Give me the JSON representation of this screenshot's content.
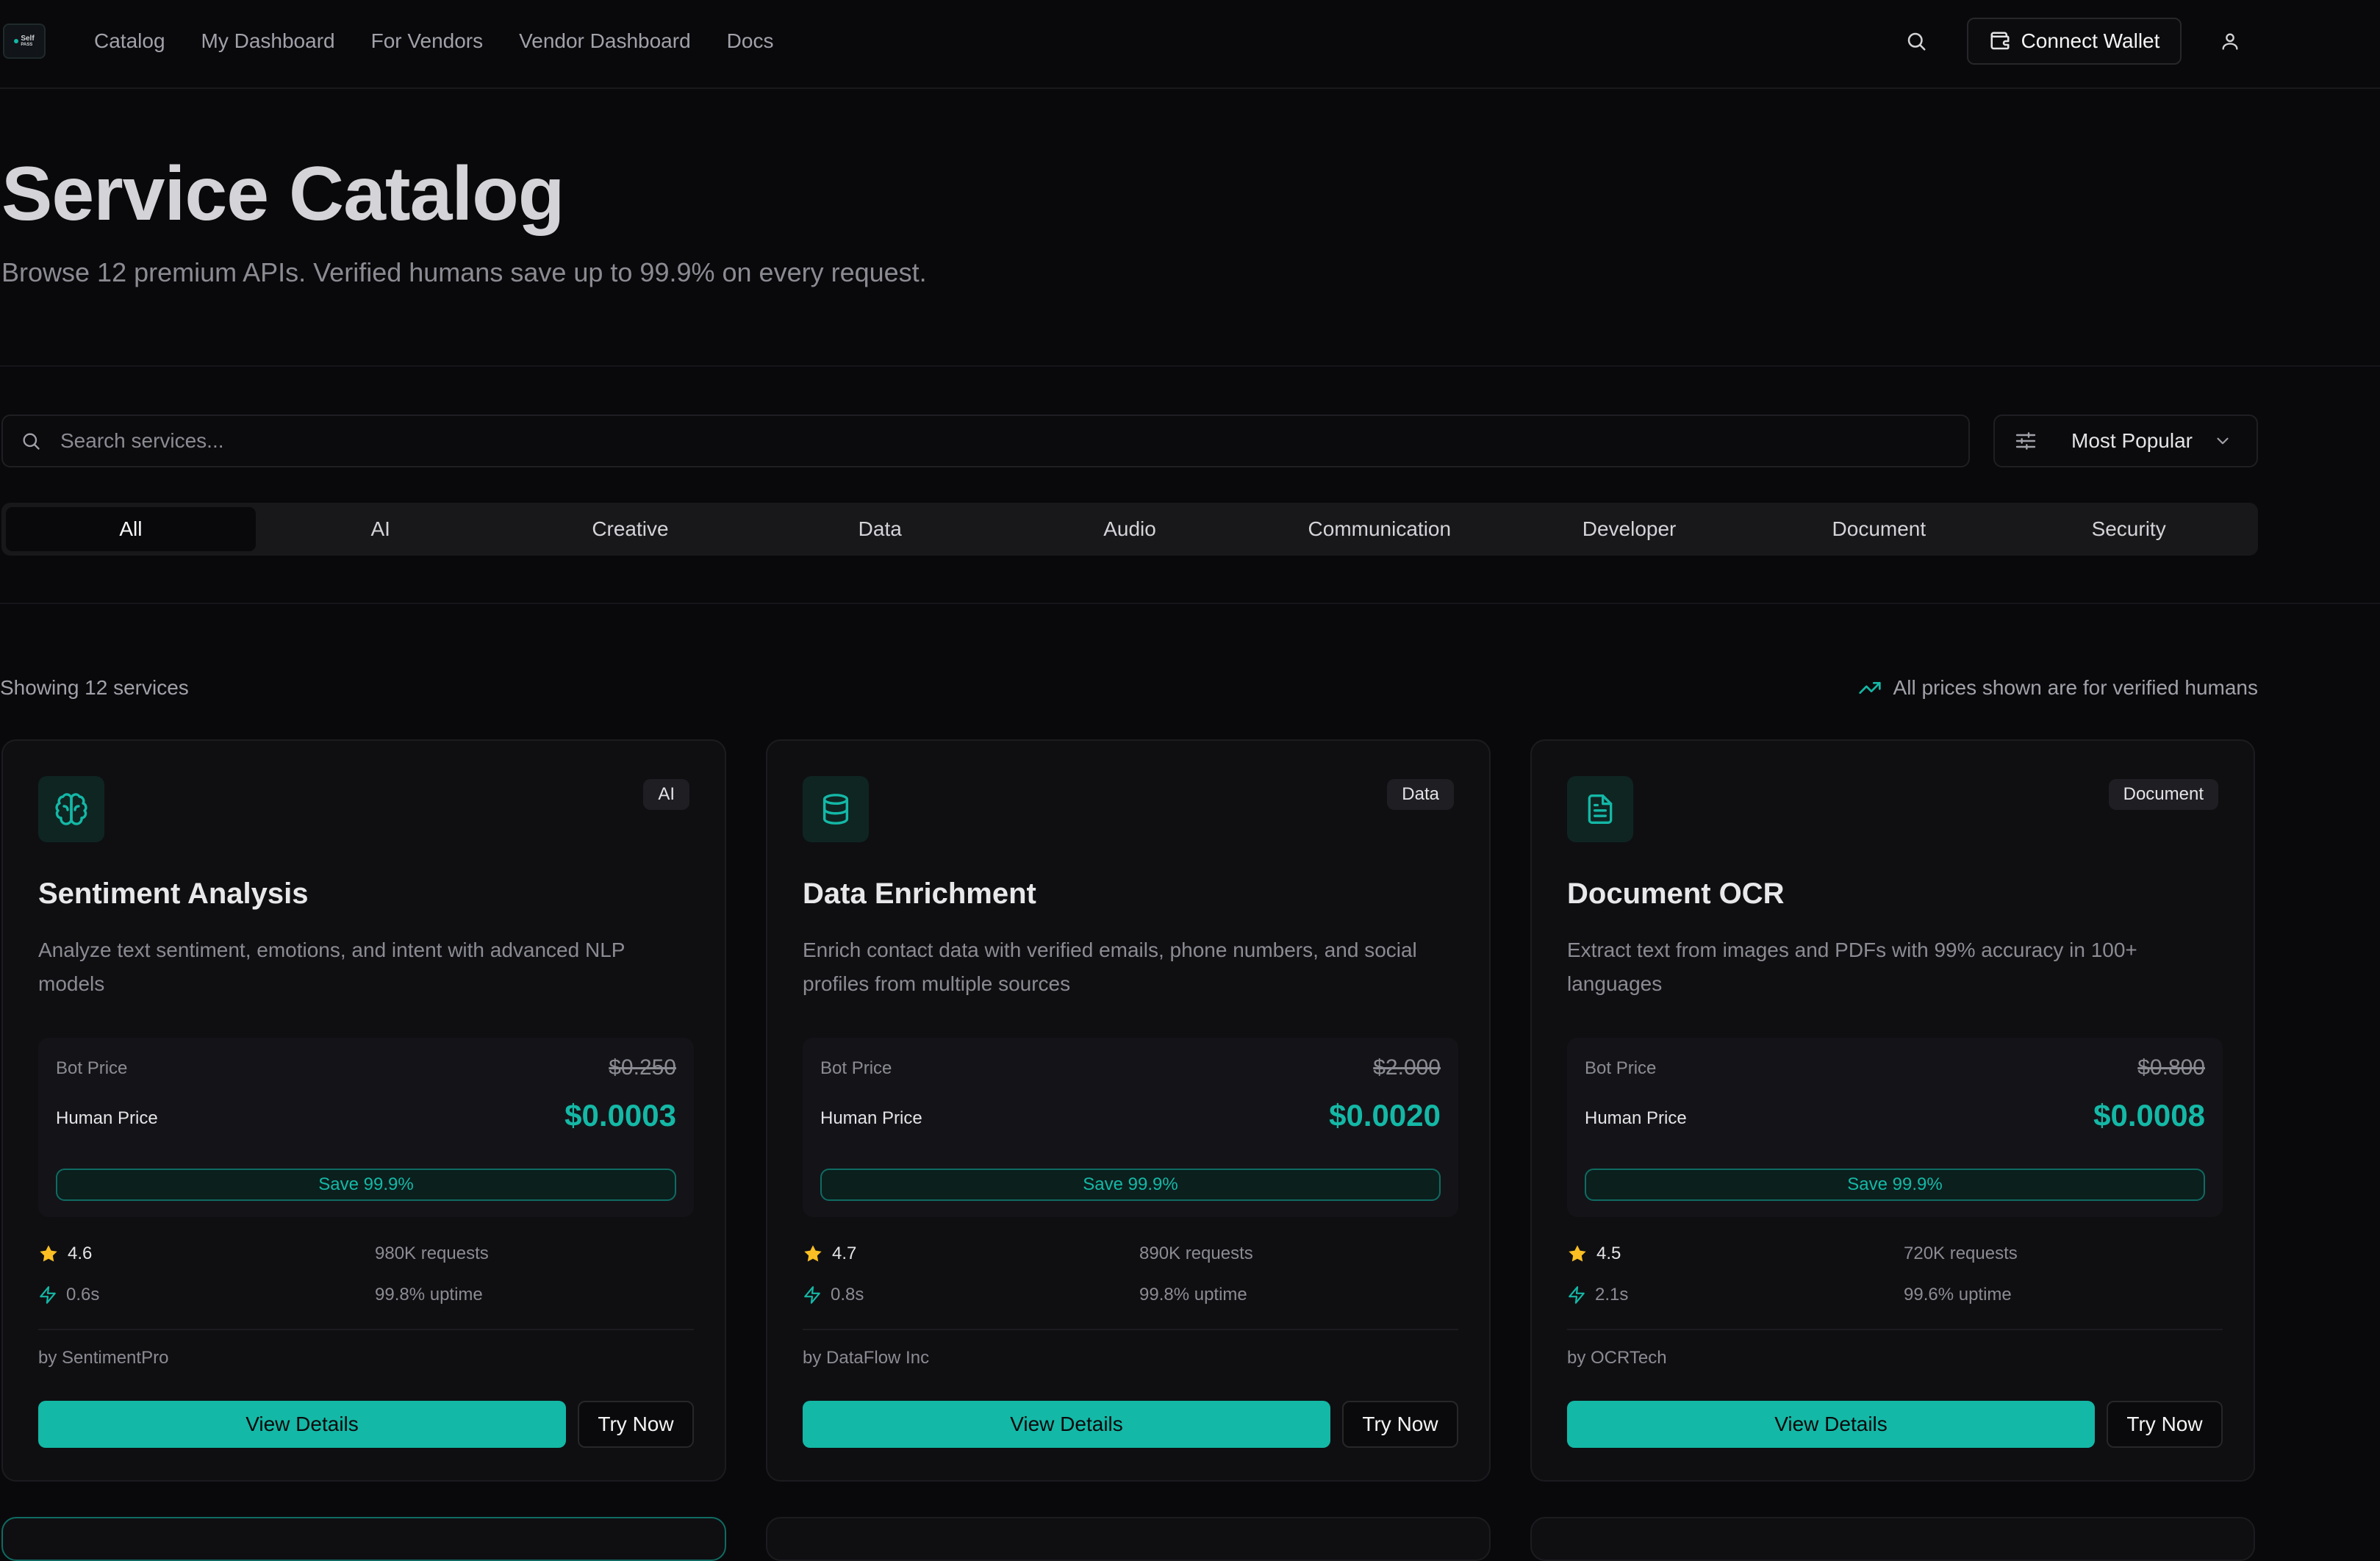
{
  "nav": {
    "logo_text": "Self",
    "logo_subtext": "PASS",
    "links": [
      "Catalog",
      "My Dashboard",
      "For Vendors",
      "Vendor Dashboard",
      "Docs"
    ],
    "search_icon": "search-icon",
    "wallet_label": "Connect Wallet",
    "wallet_icon": "wallet-icon",
    "user_icon": "user-icon"
  },
  "hero": {
    "title": "Service Catalog",
    "subtitle": "Browse 12 premium APIs. Verified humans save up to 99.9% on every request."
  },
  "search": {
    "placeholder": "Search services...",
    "value": ""
  },
  "sort": {
    "selected": "Most Popular"
  },
  "categories": {
    "active": "All",
    "items": [
      "All",
      "AI",
      "Creative",
      "Data",
      "Audio",
      "Communication",
      "Developer",
      "Document",
      "Security"
    ]
  },
  "results": {
    "count_text": "Showing 12 services",
    "pricing_note": "All prices shown are for verified humans"
  },
  "labels": {
    "bot_price": "Bot Price",
    "human_price": "Human Price",
    "view_details": "View Details",
    "try_now": "Try Now"
  },
  "colors": {
    "accent": "#14b8a6",
    "background": "#09090b",
    "card": "#0f0f12",
    "star": "#fbbf24"
  },
  "services": [
    {
      "icon": "brain-icon",
      "category": "AI",
      "title": "Sentiment Analysis",
      "description": "Analyze text sentiment, emotions, and intent with advanced NLP models",
      "bot_price": "$0.250",
      "human_price": "$0.0003",
      "savings": "Save 99.9%",
      "rating": "4.6",
      "latency": "0.6s",
      "requests": "980K requests",
      "uptime": "99.8% uptime",
      "vendor": "by SentimentPro"
    },
    {
      "icon": "database-icon",
      "category": "Data",
      "title": "Data Enrichment",
      "description": "Enrich contact data with verified emails, phone numbers, and social profiles from multiple sources",
      "bot_price": "$2.000",
      "human_price": "$0.0020",
      "savings": "Save 99.9%",
      "rating": "4.7",
      "latency": "0.8s",
      "requests": "890K requests",
      "uptime": "99.8% uptime",
      "vendor": "by DataFlow Inc"
    },
    {
      "icon": "document-icon",
      "category": "Document",
      "title": "Document OCR",
      "description": "Extract text from images and PDFs with 99% accuracy in 100+ languages",
      "bot_price": "$0.800",
      "human_price": "$0.0008",
      "savings": "Save 99.9%",
      "rating": "4.5",
      "latency": "2.1s",
      "requests": "720K requests",
      "uptime": "99.6% uptime",
      "vendor": "by OCRTech"
    }
  ]
}
